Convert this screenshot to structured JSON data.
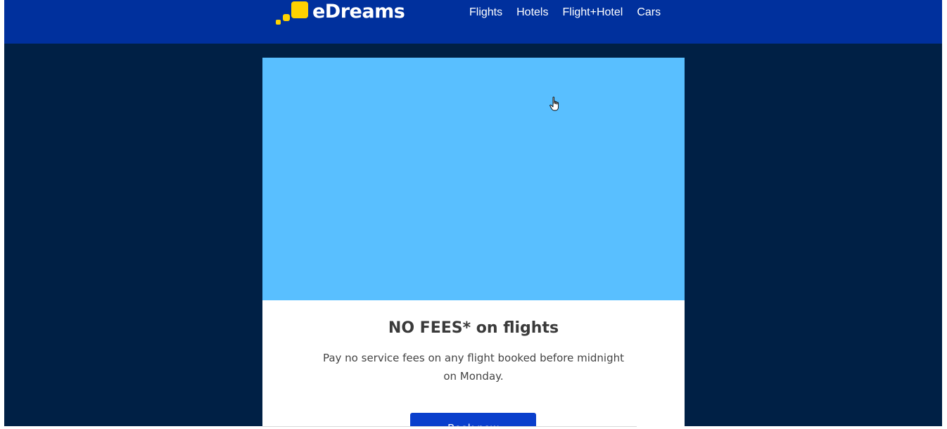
{
  "brand": {
    "name": "eDreams",
    "accent_color": "#ffd200",
    "header_color": "#00309d",
    "page_bg_color": "#002045"
  },
  "nav": {
    "items": [
      {
        "label": "Flights"
      },
      {
        "label": "Hotels"
      },
      {
        "label": "Flight+Hotel"
      },
      {
        "label": "Cars"
      }
    ]
  },
  "promo": {
    "hero_color": "#59bfff",
    "headline": "NO FEES* on flights",
    "description": "Pay no service fees on any flight booked before midnight on Monday.",
    "cta_label": "Book now",
    "cta_color": "#0a3fcc"
  }
}
